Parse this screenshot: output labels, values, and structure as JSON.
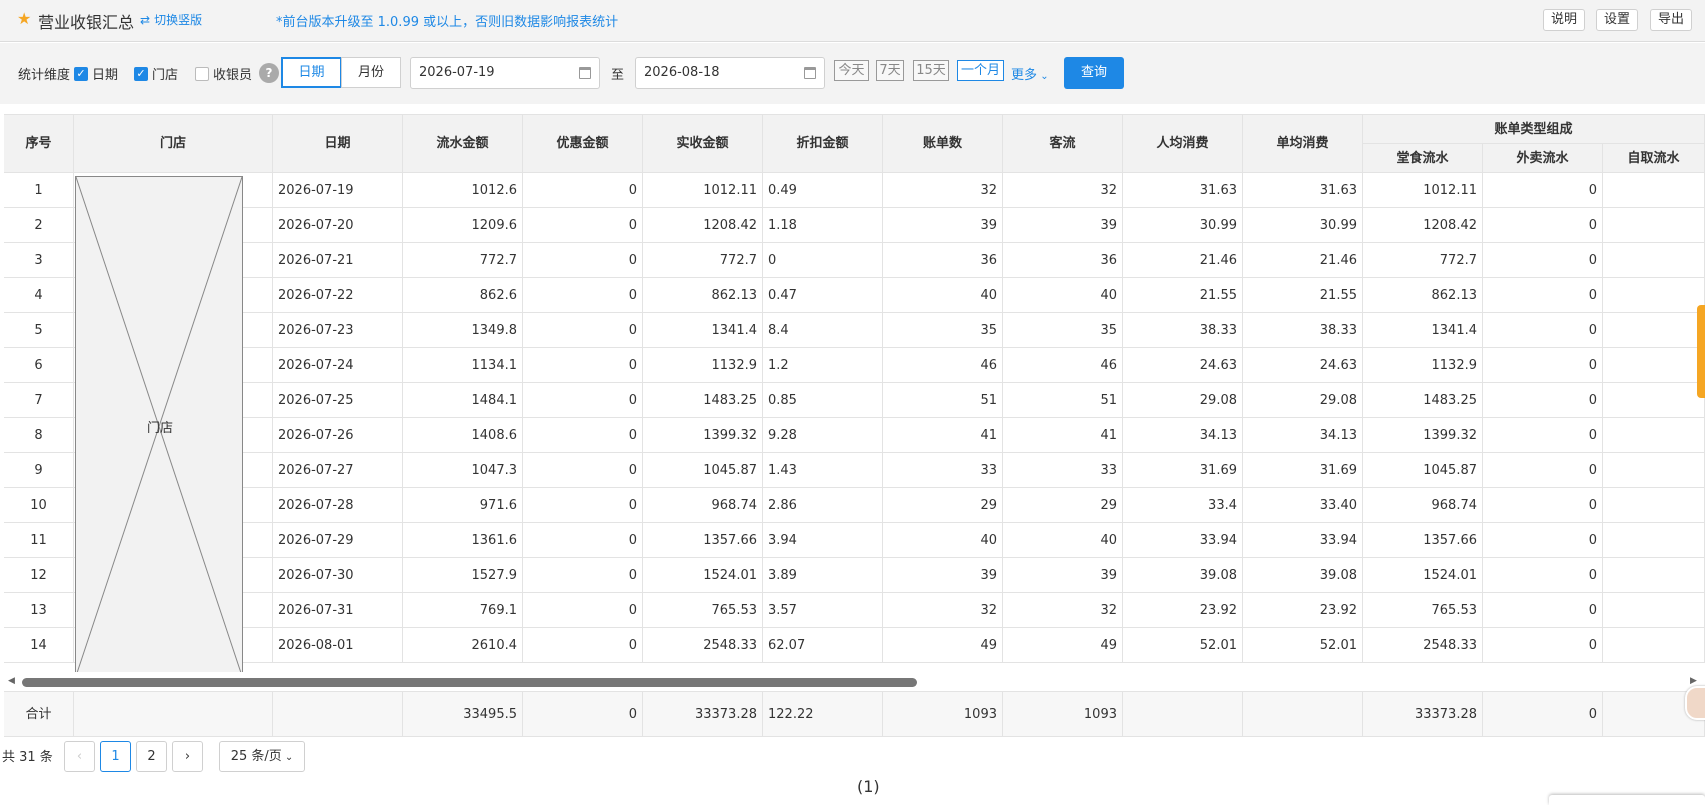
{
  "header": {
    "title": "营业收银汇总",
    "switch_label": "切换竖版",
    "notice": "*前台版本升级至 1.0.99 或以上，否则旧数据影响报表统计",
    "buttons": [
      "说明",
      "设置",
      "导出"
    ]
  },
  "filters": {
    "dimension_label": "统计维度",
    "checkboxes": [
      {
        "label": "日期",
        "checked": true
      },
      {
        "label": "门店",
        "checked": true
      },
      {
        "label": "收银员",
        "checked": false
      }
    ],
    "help": "?",
    "granularity": [
      "日期",
      "月份"
    ],
    "granularity_selected": "日期",
    "date_from": "2026-07-19",
    "to_label": "至",
    "date_to": "2026-08-18",
    "quick_ranges": [
      "今天",
      "7天",
      "15天",
      "一个月"
    ],
    "quick_selected": "一个月",
    "more_label": "更多",
    "query_label": "查询"
  },
  "table": {
    "headers": {
      "seq": "序号",
      "store": "门店",
      "date": "日期",
      "gross": "流水金额",
      "discount": "优惠金额",
      "received": "实收金额",
      "markdown": "折扣金额",
      "bills": "账单数",
      "guests": "客流",
      "per_person": "人均消费",
      "per_bill": "单均消费",
      "group": "账单类型组成",
      "dinein": "堂食流水",
      "takeout": "外卖流水",
      "pickup": "自取流水"
    },
    "store_placeholder": "门店",
    "rows": [
      [
        "1",
        "2026-07-19",
        "1012.6",
        "0",
        "1012.11",
        "0.49",
        "32",
        "32",
        "31.63",
        "31.63",
        "1012.11",
        "0"
      ],
      [
        "2",
        "2026-07-20",
        "1209.6",
        "0",
        "1208.42",
        "1.18",
        "39",
        "39",
        "30.99",
        "30.99",
        "1208.42",
        "0"
      ],
      [
        "3",
        "2026-07-21",
        "772.7",
        "0",
        "772.7",
        "0",
        "36",
        "36",
        "21.46",
        "21.46",
        "772.7",
        "0"
      ],
      [
        "4",
        "2026-07-22",
        "862.6",
        "0",
        "862.13",
        "0.47",
        "40",
        "40",
        "21.55",
        "21.55",
        "862.13",
        "0"
      ],
      [
        "5",
        "2026-07-23",
        "1349.8",
        "0",
        "1341.4",
        "8.4",
        "35",
        "35",
        "38.33",
        "38.33",
        "1341.4",
        "0"
      ],
      [
        "6",
        "2026-07-24",
        "1134.1",
        "0",
        "1132.9",
        "1.2",
        "46",
        "46",
        "24.63",
        "24.63",
        "1132.9",
        "0"
      ],
      [
        "7",
        "2026-07-25",
        "1484.1",
        "0",
        "1483.25",
        "0.85",
        "51",
        "51",
        "29.08",
        "29.08",
        "1483.25",
        "0"
      ],
      [
        "8",
        "2026-07-26",
        "1408.6",
        "0",
        "1399.32",
        "9.28",
        "41",
        "41",
        "34.13",
        "34.13",
        "1399.32",
        "0"
      ],
      [
        "9",
        "2026-07-27",
        "1047.3",
        "0",
        "1045.87",
        "1.43",
        "33",
        "33",
        "31.69",
        "31.69",
        "1045.87",
        "0"
      ],
      [
        "10",
        "2026-07-28",
        "971.6",
        "0",
        "968.74",
        "2.86",
        "29",
        "29",
        "33.4",
        "33.40",
        "968.74",
        "0"
      ],
      [
        "11",
        "2026-07-29",
        "1361.6",
        "0",
        "1357.66",
        "3.94",
        "40",
        "40",
        "33.94",
        "33.94",
        "1357.66",
        "0"
      ],
      [
        "12",
        "2026-07-30",
        "1527.9",
        "0",
        "1524.01",
        "3.89",
        "39",
        "39",
        "39.08",
        "39.08",
        "1524.01",
        "0"
      ],
      [
        "13",
        "2026-07-31",
        "769.1",
        "0",
        "765.53",
        "3.57",
        "32",
        "32",
        "23.92",
        "23.92",
        "765.53",
        "0"
      ],
      [
        "14",
        "2026-08-01",
        "2610.4",
        "0",
        "2548.33",
        "62.07",
        "49",
        "49",
        "52.01",
        "52.01",
        "2548.33",
        "0"
      ]
    ],
    "footer": {
      "label": "合计",
      "gross": "33495.5",
      "discount": "0",
      "received": "33373.28",
      "markdown": "122.22",
      "bills": "1093",
      "guests": "1093",
      "dinein": "33373.28",
      "takeout": "0"
    }
  },
  "pagination": {
    "total": "共 31 条",
    "prev": "‹",
    "pages": [
      "1",
      "2"
    ],
    "current": "1",
    "next": "›",
    "page_size": "25 条/页"
  },
  "caption": "(1)",
  "colors": {
    "accent": "#1e88e5",
    "star": "#f5a623",
    "header_bg": "#f3f3f3"
  }
}
